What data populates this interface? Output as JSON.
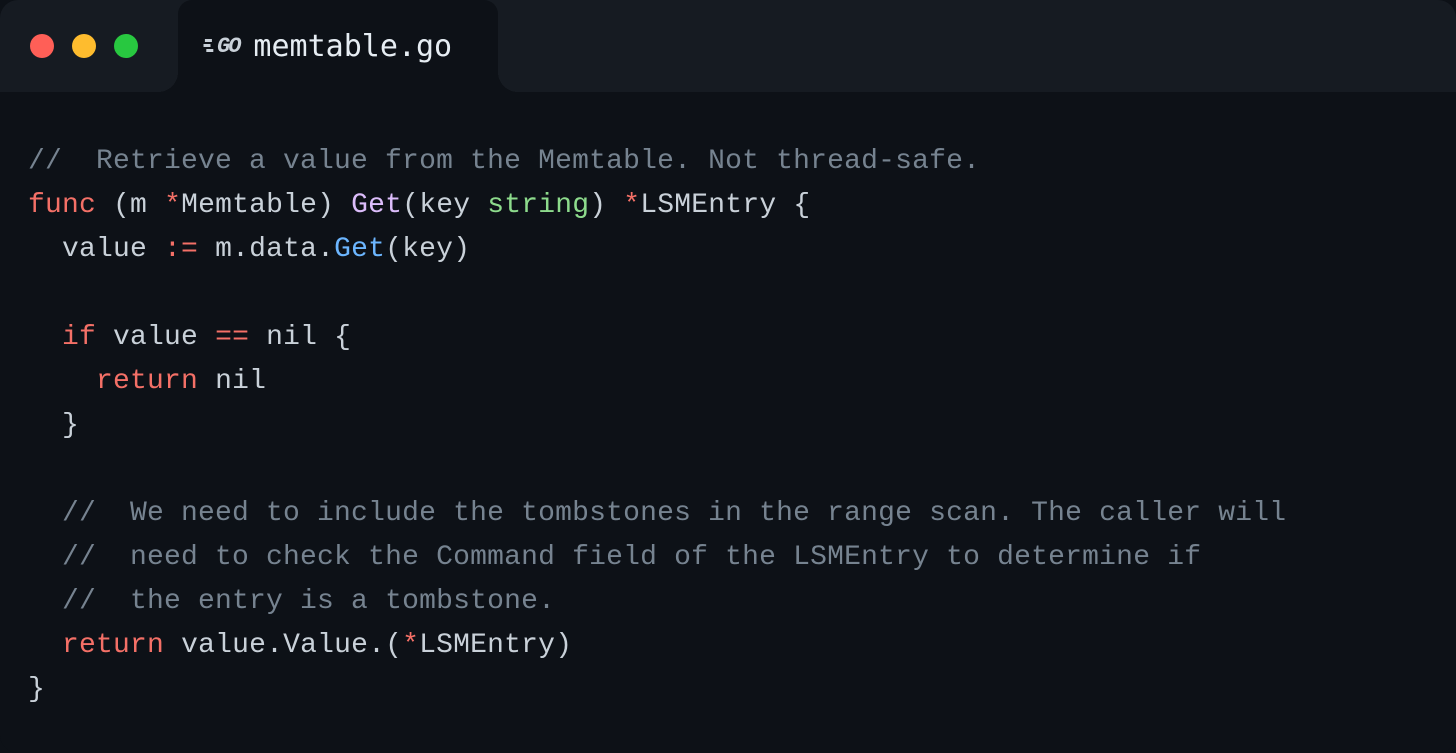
{
  "tab": {
    "filename": "memtable.go",
    "icon": "GO"
  },
  "code": {
    "lines": [
      {
        "indent": 0,
        "tokens": [
          {
            "cls": "tok-comment",
            "t": "//  Retrieve a value from the Memtable. Not thread-safe."
          }
        ]
      },
      {
        "indent": 0,
        "tokens": [
          {
            "cls": "tok-keyword",
            "t": "func"
          },
          {
            "cls": "",
            "t": " "
          },
          {
            "cls": "tok-punct",
            "t": "("
          },
          {
            "cls": "tok-ident",
            "t": "m"
          },
          {
            "cls": "",
            "t": " "
          },
          {
            "cls": "tok-star",
            "t": "*"
          },
          {
            "cls": "tok-ident",
            "t": "Memtable"
          },
          {
            "cls": "tok-punct",
            "t": ")"
          },
          {
            "cls": "",
            "t": " "
          },
          {
            "cls": "tok-funcname",
            "t": "Get"
          },
          {
            "cls": "tok-punct",
            "t": "("
          },
          {
            "cls": "tok-ident",
            "t": "key"
          },
          {
            "cls": "",
            "t": " "
          },
          {
            "cls": "tok-type",
            "t": "string"
          },
          {
            "cls": "tok-punct",
            "t": ")"
          },
          {
            "cls": "",
            "t": " "
          },
          {
            "cls": "tok-star",
            "t": "*"
          },
          {
            "cls": "tok-ident",
            "t": "LSMEntry"
          },
          {
            "cls": "",
            "t": " "
          },
          {
            "cls": "tok-punct",
            "t": "{"
          }
        ]
      },
      {
        "indent": 1,
        "tokens": [
          {
            "cls": "tok-ident",
            "t": "value"
          },
          {
            "cls": "",
            "t": " "
          },
          {
            "cls": "tok-op",
            "t": ":="
          },
          {
            "cls": "",
            "t": " "
          },
          {
            "cls": "tok-ident",
            "t": "m"
          },
          {
            "cls": "tok-punct",
            "t": "."
          },
          {
            "cls": "tok-ident",
            "t": "data"
          },
          {
            "cls": "tok-punct",
            "t": "."
          },
          {
            "cls": "tok-call",
            "t": "Get"
          },
          {
            "cls": "tok-punct",
            "t": "("
          },
          {
            "cls": "tok-ident",
            "t": "key"
          },
          {
            "cls": "tok-punct",
            "t": ")"
          }
        ]
      },
      {
        "indent": 0,
        "tokens": []
      },
      {
        "indent": 1,
        "tokens": [
          {
            "cls": "tok-keyword",
            "t": "if"
          },
          {
            "cls": "",
            "t": " "
          },
          {
            "cls": "tok-ident",
            "t": "value"
          },
          {
            "cls": "",
            "t": " "
          },
          {
            "cls": "tok-op",
            "t": "=="
          },
          {
            "cls": "",
            "t": " "
          },
          {
            "cls": "tok-ident",
            "t": "nil"
          },
          {
            "cls": "",
            "t": " "
          },
          {
            "cls": "tok-punct",
            "t": "{"
          }
        ]
      },
      {
        "indent": 2,
        "tokens": [
          {
            "cls": "tok-keyword",
            "t": "return"
          },
          {
            "cls": "",
            "t": " "
          },
          {
            "cls": "tok-ident",
            "t": "nil"
          }
        ]
      },
      {
        "indent": 1,
        "tokens": [
          {
            "cls": "tok-punct",
            "t": "}"
          }
        ]
      },
      {
        "indent": 0,
        "tokens": []
      },
      {
        "indent": 1,
        "tokens": [
          {
            "cls": "tok-comment",
            "t": "//  We need to include the tombstones in the range scan. The caller will"
          }
        ]
      },
      {
        "indent": 1,
        "tokens": [
          {
            "cls": "tok-comment",
            "t": "//  need to check the Command field of the LSMEntry to determine if"
          }
        ]
      },
      {
        "indent": 1,
        "tokens": [
          {
            "cls": "tok-comment",
            "t": "//  the entry is a tombstone."
          }
        ]
      },
      {
        "indent": 1,
        "tokens": [
          {
            "cls": "tok-keyword",
            "t": "return"
          },
          {
            "cls": "",
            "t": " "
          },
          {
            "cls": "tok-ident",
            "t": "value"
          },
          {
            "cls": "tok-punct",
            "t": "."
          },
          {
            "cls": "tok-ident",
            "t": "Value"
          },
          {
            "cls": "tok-punct",
            "t": "."
          },
          {
            "cls": "tok-punct",
            "t": "("
          },
          {
            "cls": "tok-star",
            "t": "*"
          },
          {
            "cls": "tok-ident",
            "t": "LSMEntry"
          },
          {
            "cls": "tok-punct",
            "t": ")"
          }
        ]
      },
      {
        "indent": 0,
        "tokens": [
          {
            "cls": "tok-punct",
            "t": "}"
          }
        ]
      }
    ]
  }
}
